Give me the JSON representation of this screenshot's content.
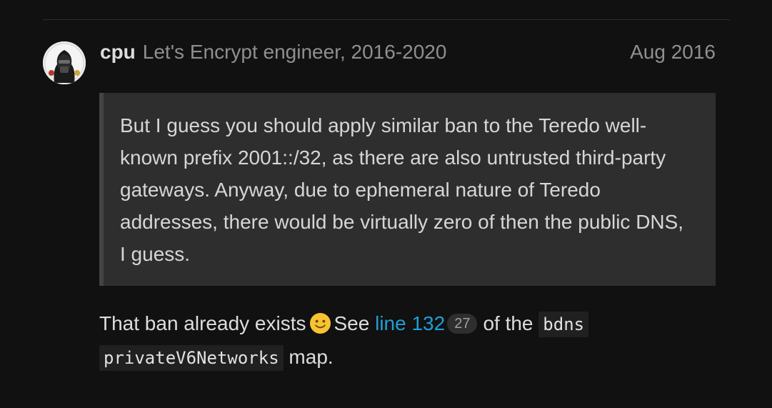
{
  "post": {
    "author": {
      "username": "cpu",
      "title": "Let's Encrypt engineer, 2016-2020",
      "avatar_icon": "user-avatar"
    },
    "date": "Aug 2016",
    "quote": {
      "text": "But I guess you should apply similar ban to the Teredo well-known prefix 2001::/32, as there are also untrusted third-party gateways. Anyway, due to ephemeral nature of Teredo addresses, there would be virtually zero of then the public DNS, I guess."
    },
    "reply": {
      "text_1": "That ban already exists",
      "emoji_icon": "slightly-smiling-face-icon",
      "text_2": "See",
      "link_text": "line 132",
      "link_clicks": "27",
      "text_3": "of the",
      "code_1": "bdns",
      "code_2": "privateV6Networks",
      "text_4": "map."
    }
  },
  "colors": {
    "background": "#111111",
    "quote_background": "#2e2e2e",
    "quote_border": "#444444",
    "link": "#1e9fd6",
    "muted_text": "#8f8f8f"
  }
}
